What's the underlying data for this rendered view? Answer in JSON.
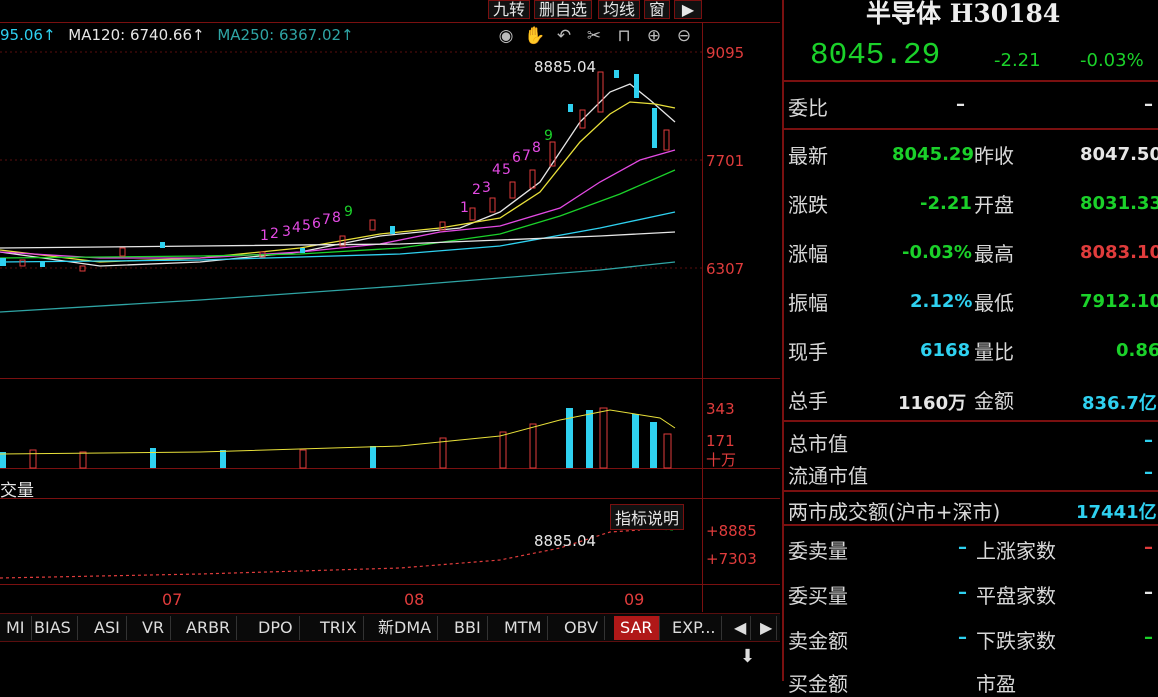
{
  "toolbar": {
    "btn1": "九转",
    "btn2": "删自选",
    "btn3": "均线",
    "btn4": "窗",
    "icon": "exit-icon"
  },
  "ma": {
    "ma60": "95.06↑",
    "ma120": "MA120: 6740.66↑",
    "ma250": "MA250: 6367.02↑"
  },
  "yaxis": {
    "main": [
      "9095",
      "7701",
      "6307"
    ],
    "vol": [
      "343",
      "171",
      "十万"
    ],
    "sar": [
      "+8885",
      "+7303"
    ]
  },
  "annot": {
    "peak": "8885.04",
    "peak2": "8885.04",
    "vol_label": "交量",
    "indicator_help": "指标说明"
  },
  "xaxis": [
    "07",
    "08",
    "09"
  ],
  "tabs": [
    "MI",
    "BIAS",
    "ASI",
    "VR",
    "ARBR",
    "DPO",
    "TRIX",
    "新DMA",
    "BBI",
    "MTM",
    "OBV",
    "SAR",
    "EXP..."
  ],
  "active_tab": "SAR",
  "panel": {
    "name": "半导体 H30184",
    "price": "8045.29",
    "change": "-2.21",
    "pct": "-0.03%",
    "weibi_label": "委比",
    "weibi_v1": "–",
    "weibi_v2": "–",
    "rows": [
      {
        "l1": "最新",
        "v1": "8045.29",
        "l2": "昨收",
        "v2": "8047.50"
      },
      {
        "l1": "涨跌",
        "v1": "-2.21",
        "l2": "开盘",
        "v2": "8031.33"
      },
      {
        "l1": "涨幅",
        "v1": "-0.03%",
        "l2": "最高",
        "v2": "8083.10"
      },
      {
        "l1": "振幅",
        "v1": "2.12%",
        "l2": "最低",
        "v2": "7912.10"
      },
      {
        "l1": "现手",
        "v1": "6168",
        "l2": "量比",
        "v2": "0.86"
      },
      {
        "l1": "总手",
        "v1": "1160万",
        "l2": "金额",
        "v2": "836.7亿"
      }
    ],
    "zsz_label": "总市值",
    "zsz_val": "–",
    "ltsz_label": "流通市值",
    "ltsz_val": "–",
    "market_label": "两市成交额(沪市+深市)",
    "market_val": "17441亿",
    "bottom": [
      {
        "l1": "委卖量",
        "v1": "–",
        "l2": "上涨家数",
        "v2": "–"
      },
      {
        "l1": "委买量",
        "v1": "–",
        "l2": "平盘家数",
        "v2": "–"
      },
      {
        "l1": "卖金额",
        "v1": "–",
        "l2": "下跌家数",
        "v2": "–"
      },
      {
        "l1": "买金额",
        "v1": "",
        "l2": "市盈",
        "v2": ""
      }
    ]
  },
  "colors": {
    "up": "#e03c3c",
    "down": "#1bd12a",
    "cyan": "#2fd1f0",
    "grid": "#7a1010"
  }
}
